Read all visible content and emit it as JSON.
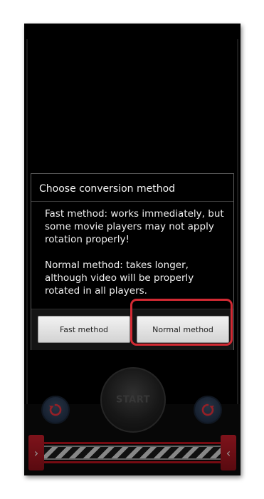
{
  "app": {
    "start_label": "START",
    "rotate_left_icon": "rotate-left-icon",
    "rotate_right_icon": "rotate-right-icon",
    "timeline_left_glyph": "›",
    "timeline_right_glyph": "‹"
  },
  "dialog": {
    "title": "Choose conversion method",
    "paragraph_fast": "Fast method: works immediately, but some movie players may not apply rotation properly!",
    "paragraph_normal": "Normal method: takes longer, although video will be properly rotated in all players.",
    "buttons": {
      "fast": "Fast method",
      "normal": "Normal method"
    }
  },
  "colors": {
    "highlight": "#d22a33",
    "timeline_red": "#c21e2a",
    "rotate_blue": "#2c3e57"
  }
}
